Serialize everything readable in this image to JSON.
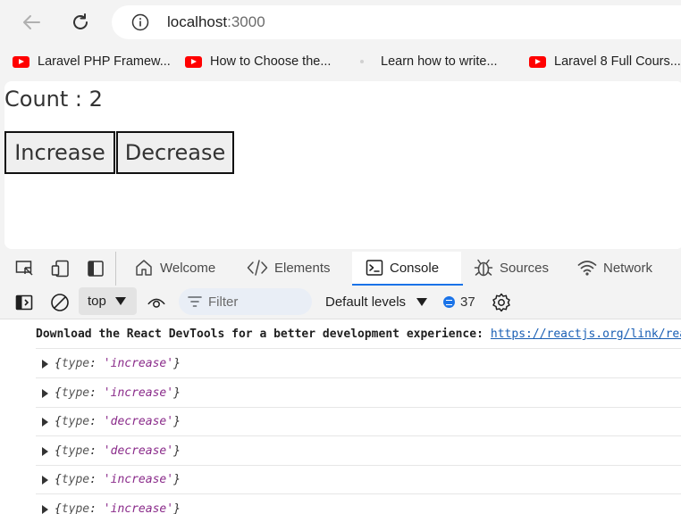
{
  "browser": {
    "url_host": "localhost",
    "url_port": ":3000"
  },
  "bookmarks": [
    {
      "label": "Laravel PHP Framew...",
      "icon": "youtube-icon"
    },
    {
      "label": "How to Choose the...",
      "icon": "youtube-icon"
    },
    {
      "label": "Learn how to write...",
      "icon": "site-icon"
    },
    {
      "label": "Laravel 8 Full Cours...",
      "icon": "youtube-icon"
    }
  ],
  "app": {
    "count_text": "Count : 2",
    "increase_label": "Increase",
    "decrease_label": "Decrease"
  },
  "devtools": {
    "tabs": [
      {
        "label": "Welcome",
        "icon": "home-icon"
      },
      {
        "label": "Elements",
        "icon": "code-icon"
      },
      {
        "label": "Console",
        "icon": "console-icon",
        "active": true
      },
      {
        "label": "Sources",
        "icon": "bug-icon"
      },
      {
        "label": "Network",
        "icon": "wifi-icon"
      }
    ],
    "console": {
      "context": "top",
      "filter_placeholder": "Filter",
      "levels": "Default levels",
      "message_count": "37",
      "lines": [
        {
          "kind": "text",
          "message": "Download the React DevTools for a better development experience:",
          "link": "https://reactjs.org/link/react-devtools"
        },
        {
          "kind": "object",
          "open": "{",
          "key": "type",
          "sep": ": ",
          "value": "'increase'",
          "close": "}"
        },
        {
          "kind": "object",
          "open": "{",
          "key": "type",
          "sep": ": ",
          "value": "'increase'",
          "close": "}"
        },
        {
          "kind": "object",
          "open": "{",
          "key": "type",
          "sep": ": ",
          "value": "'decrease'",
          "close": "}"
        },
        {
          "kind": "object",
          "open": "{",
          "key": "type",
          "sep": ": ",
          "value": "'decrease'",
          "close": "}"
        },
        {
          "kind": "object",
          "open": "{",
          "key": "type",
          "sep": ": ",
          "value": "'increase'",
          "close": "}"
        },
        {
          "kind": "object",
          "open": "{",
          "key": "type",
          "sep": ": ",
          "value": "'increase'",
          "close": "}"
        }
      ]
    }
  },
  "colors": {
    "accent": "#1a73e8",
    "youtube": "#ff0000",
    "string_value": "#8a2b8a"
  }
}
